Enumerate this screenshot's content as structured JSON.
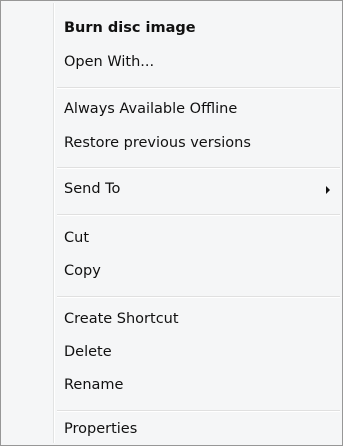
{
  "context_menu": {
    "items": [
      {
        "label": "Burn disc image",
        "bold": true
      },
      {
        "label": "Open With..."
      },
      {
        "label": "Always Available Offline"
      },
      {
        "label": "Restore previous versions"
      },
      {
        "label": "Send To",
        "submenu": true
      },
      {
        "label": "Cut"
      },
      {
        "label": "Copy"
      },
      {
        "label": "Create Shortcut"
      },
      {
        "label": "Delete"
      },
      {
        "label": "Rename"
      },
      {
        "label": "Properties"
      }
    ]
  }
}
